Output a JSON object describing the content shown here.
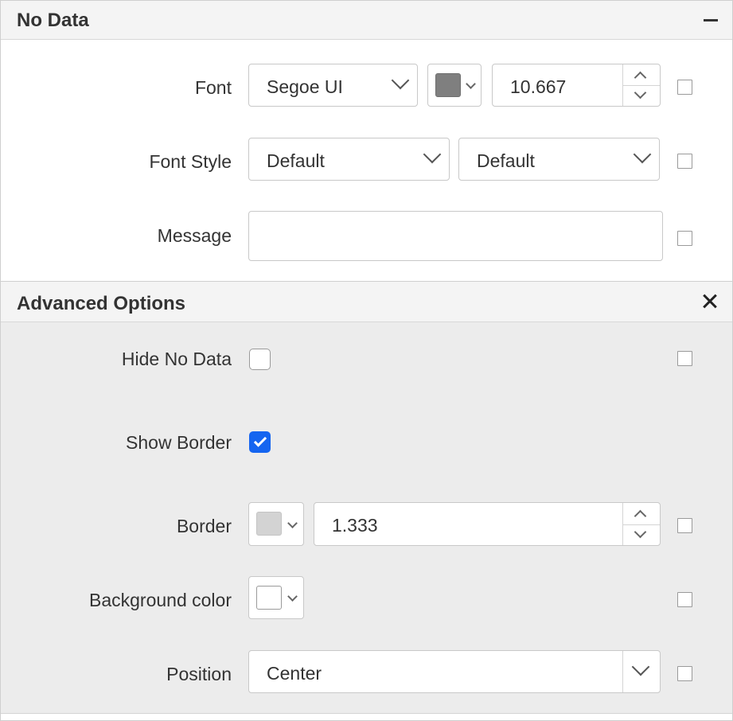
{
  "no_data": {
    "title": "No Data",
    "collapse_icon": "minus-icon",
    "font": {
      "label": "Font",
      "family": "Segoe UI",
      "color": "#7f7f7f",
      "size": "10.667"
    },
    "font_style": {
      "label": "Font Style",
      "style": "Default",
      "weight": "Default"
    },
    "message": {
      "label": "Message",
      "value": ""
    }
  },
  "advanced": {
    "title": "Advanced Options",
    "close_icon": "close-icon",
    "hide_no_data": {
      "label": "Hide No Data",
      "checked": false
    },
    "show_border": {
      "label": "Show Border",
      "checked": true
    },
    "border": {
      "label": "Border",
      "color": "#d3d3d3",
      "width": "1.333"
    },
    "background_color": {
      "label": "Background color",
      "color": "#ffffff"
    },
    "position": {
      "label": "Position",
      "value": "Center"
    }
  },
  "colors": {
    "accent": "#1565f0",
    "header_bg": "#f4f4f4",
    "advanced_bg": "#ececec"
  }
}
